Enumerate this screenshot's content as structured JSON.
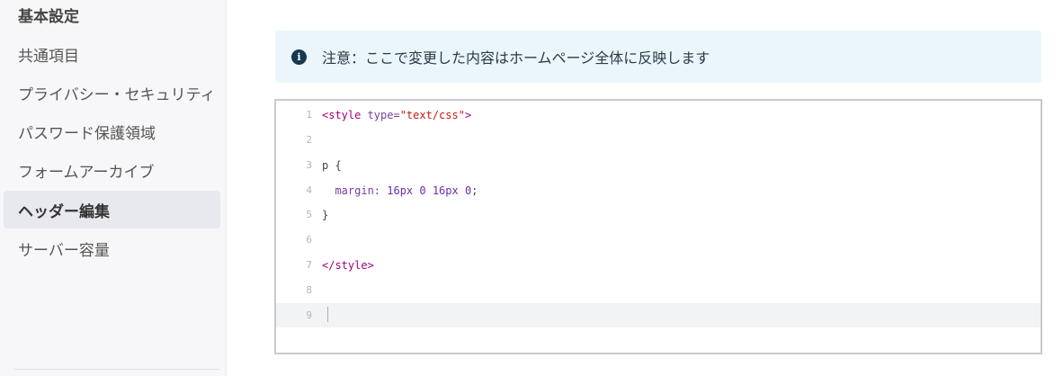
{
  "sidebar": {
    "items": [
      {
        "label": "基本設定"
      },
      {
        "label": "共通項目"
      },
      {
        "label": "プライバシー・セキュリティ"
      },
      {
        "label": "パスワード保護領域"
      },
      {
        "label": "フォームアーカイブ"
      },
      {
        "label": "ヘッダー編集"
      },
      {
        "label": "サーバー容量"
      }
    ],
    "active_index": 5
  },
  "notice": {
    "icon": "info-circle-icon",
    "text": "注意：ここで変更した内容はホームページ全体に反映します"
  },
  "editor": {
    "lines": [
      {
        "num": "1",
        "parts": [
          [
            "tag",
            "<style "
          ],
          [
            "attr",
            "type="
          ],
          [
            "str",
            "\"text/css\""
          ],
          [
            "tag",
            ">"
          ]
        ]
      },
      {
        "num": "2",
        "parts": []
      },
      {
        "num": "3",
        "parts": [
          [
            "plain",
            "p {"
          ]
        ]
      },
      {
        "num": "4",
        "parts": [
          [
            "prop",
            "  margin: "
          ],
          [
            "num",
            "16px 0 16px 0"
          ],
          [
            "plain",
            ";"
          ]
        ]
      },
      {
        "num": "5",
        "parts": [
          [
            "plain",
            "}"
          ]
        ]
      },
      {
        "num": "6",
        "parts": []
      },
      {
        "num": "7",
        "parts": [
          [
            "tag",
            "</style>"
          ]
        ]
      },
      {
        "num": "8",
        "parts": []
      },
      {
        "num": "9",
        "parts": []
      }
    ],
    "active_line": 9
  },
  "colors": {
    "sidebar_bg": "#f7f7f9",
    "active_item_bg": "#e8e8ef",
    "notice_bg": "#ebf6fb",
    "notice_icon": "#17384e",
    "tag_color": "#a3007a",
    "string_color": "#c41a16"
  }
}
